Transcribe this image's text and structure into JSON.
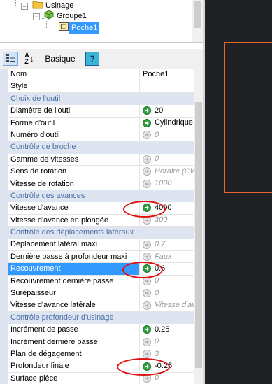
{
  "tree": {
    "items": [
      {
        "label": "Usinage",
        "icon": "folder-icon"
      },
      {
        "label": "Groupe1",
        "icon": "group-cube-icon"
      },
      {
        "label": "Poche1",
        "icon": "pocket-icon",
        "selected": true
      }
    ]
  },
  "toolbar": {
    "categorized_icon": "categorized-view-icon",
    "sort_icon_text": "A↓Z",
    "mode_label": "Basique",
    "help_label": "?"
  },
  "properties": [
    {
      "type": "prop",
      "name": "Nom",
      "value": "Poche1",
      "icon": "none"
    },
    {
      "type": "prop",
      "name": "Style",
      "value": "",
      "icon": "none"
    },
    {
      "type": "cat",
      "name": "Choix de l'outil"
    },
    {
      "type": "prop",
      "name": "Diamètre de l'outil",
      "value": "20",
      "icon": "on"
    },
    {
      "type": "prop",
      "name": "Forme d'outil",
      "value": "Cylindrique",
      "icon": "on"
    },
    {
      "type": "prop",
      "name": "Numéro d'outil",
      "value": "0",
      "icon": "off"
    },
    {
      "type": "cat",
      "name": "Contrôle de broche"
    },
    {
      "type": "prop",
      "name": "Gamme de vitesses",
      "value": "0",
      "icon": "off"
    },
    {
      "type": "prop",
      "name": "Sens de rotation",
      "value": "Horaire (CW)",
      "icon": "off"
    },
    {
      "type": "prop",
      "name": "Vitesse de rotation",
      "value": "1000",
      "icon": "off"
    },
    {
      "type": "cat",
      "name": "Contrôle des avances"
    },
    {
      "type": "prop",
      "name": "Vitesse d'avance",
      "value": "4000",
      "icon": "on"
    },
    {
      "type": "prop",
      "name": "Vitesse d'avance en plongée",
      "value": "300",
      "icon": "off"
    },
    {
      "type": "cat",
      "name": "Contrôle des déplacements latéraux"
    },
    {
      "type": "prop",
      "name": "Déplacement latéral maxi",
      "value": "0.7",
      "icon": "off"
    },
    {
      "type": "prop",
      "name": "Dernière passe à profondeur maxi",
      "value": "Faux",
      "icon": "off"
    },
    {
      "type": "prop",
      "name": "Recouvrement",
      "value": "0.6",
      "icon": "on",
      "selected": true
    },
    {
      "type": "prop",
      "name": "Recouvrement dernière passe",
      "value": "0",
      "icon": "off"
    },
    {
      "type": "prop",
      "name": "Surépaisseur",
      "value": "0",
      "icon": "off"
    },
    {
      "type": "prop",
      "name": "Vitesse d'avance latérale",
      "value": "Vitesse d'avance",
      "icon": "off"
    },
    {
      "type": "cat",
      "name": "Contrôle profondeur d'usinage"
    },
    {
      "type": "prop",
      "name": "Incrément de passe",
      "value": "0.25",
      "icon": "on"
    },
    {
      "type": "prop",
      "name": "Incrément dernière passe",
      "value": "0",
      "icon": "off"
    },
    {
      "type": "prop",
      "name": "Plan de dégagement",
      "value": "3",
      "icon": "off"
    },
    {
      "type": "prop",
      "name": "Profondeur finale",
      "value": "-0.25",
      "icon": "on"
    },
    {
      "type": "prop",
      "name": "Surface pièce",
      "value": "0",
      "icon": "off"
    }
  ],
  "highlighted_values": [
    "Vitesse d'avance",
    "Recouvrement",
    "Profondeur finale"
  ],
  "colors": {
    "category_bg": "#dfe5f0",
    "category_text": "#4a6fa8",
    "selection": "#3399ff",
    "active_icon": "#2f9e3f",
    "highlight_ellipse": "#e01010",
    "viewport_bg": "#1f2124",
    "rectangle": "#e8652a"
  }
}
